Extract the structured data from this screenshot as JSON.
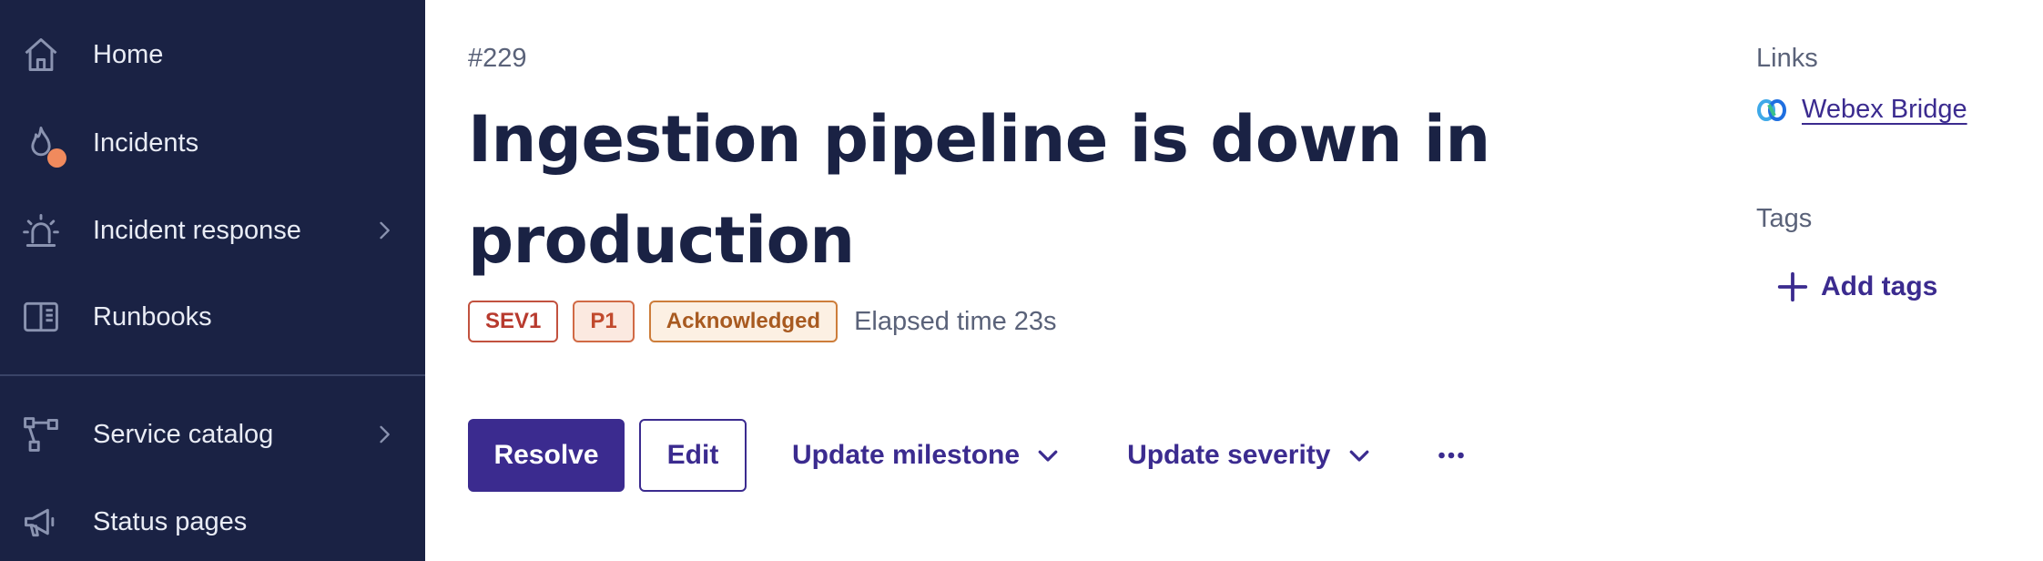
{
  "sidebar": {
    "items": [
      {
        "label": "Home",
        "icon": "home-icon",
        "has_submenu": false
      },
      {
        "label": "Incidents",
        "icon": "flame-icon",
        "has_submenu": false,
        "notification_dot": true
      },
      {
        "label": "Incident response",
        "icon": "siren-icon",
        "has_submenu": true
      },
      {
        "label": "Runbooks",
        "icon": "book-icon",
        "has_submenu": false
      },
      {
        "label": "Service catalog",
        "icon": "graph-icon",
        "has_submenu": true
      },
      {
        "label": "Status pages",
        "icon": "megaphone-icon",
        "has_submenu": false
      }
    ]
  },
  "incident": {
    "id": "#229",
    "title": "Ingestion pipeline is down in production",
    "chips": {
      "severity": "SEV1",
      "priority": "P1",
      "status": "Acknowledged"
    },
    "elapsed": "Elapsed time 23s"
  },
  "actions": {
    "resolve": "Resolve",
    "edit": "Edit",
    "update_milestone": "Update milestone",
    "update_severity": "Update severity",
    "more_icon": "more-horizontal-icon"
  },
  "right_panel": {
    "links_label": "Links",
    "links": [
      {
        "label": "Webex Bridge",
        "icon": "webex-icon"
      }
    ],
    "tags_label": "Tags",
    "add_tags": "Add tags"
  },
  "colors": {
    "sidebar_bg": "#1a2244",
    "primary": "#3b2b8f",
    "title": "#1a2244",
    "notification": "#f08a5d"
  }
}
